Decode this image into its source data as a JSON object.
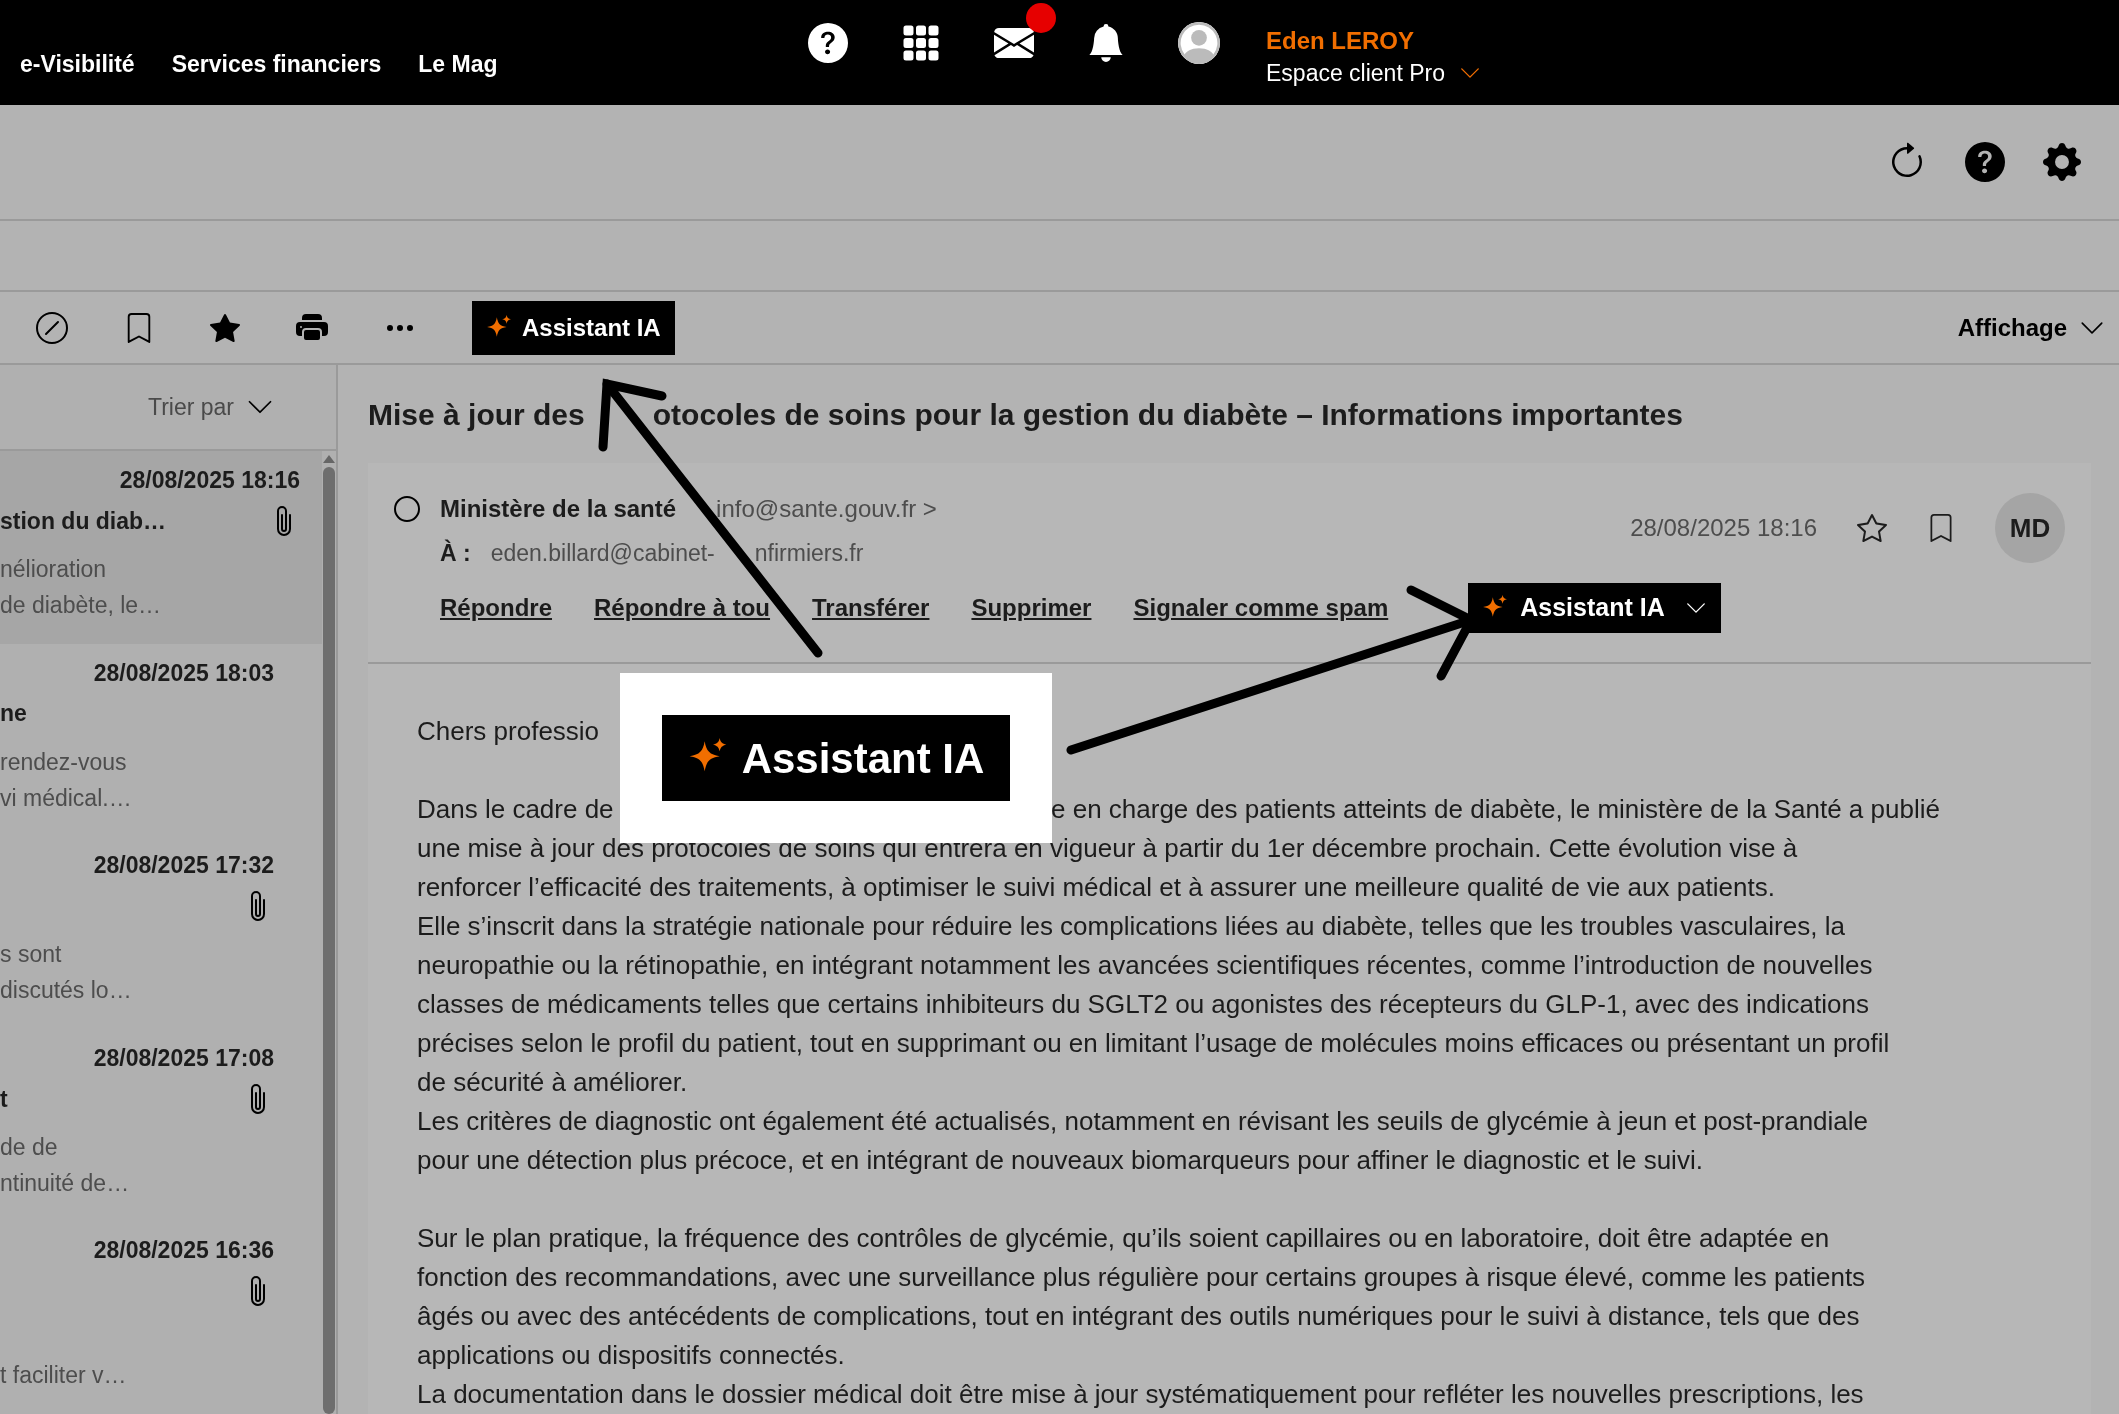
{
  "header": {
    "nav_links": [
      "e-Visibilité",
      "Services financiers",
      "Le Mag"
    ],
    "mail_unread": true,
    "user": {
      "name": "Eden LEROY",
      "account": "Espace client Pro"
    }
  },
  "toolbar": {
    "assistant_button": "Assistant IA",
    "view_menu": "Affichage"
  },
  "message_list": {
    "sort_label": "Trier par",
    "items": [
      {
        "date": "28/08/2025 18:16",
        "subject": "stion du diab…",
        "preview": [
          "nélioration",
          "de diabète, le…"
        ],
        "attachment": true,
        "selected": true
      },
      {
        "date": "28/08/2025 18:03",
        "subject": "ne",
        "preview": [
          "rendez-vous",
          "vi médical.…"
        ],
        "attachment": false,
        "selected": false
      },
      {
        "date": "28/08/2025 17:32",
        "preview": [
          "s sont",
          "discutés lo…"
        ],
        "attachment": true,
        "selected": false
      },
      {
        "date": "28/08/2025 17:08",
        "subject": "t",
        "preview": [
          "de de",
          "ntinuité de…"
        ],
        "attachment": true,
        "selected": false
      },
      {
        "date": "28/08/2025 16:36",
        "preview": [
          "t faciliter v…"
        ],
        "attachment": true,
        "selected": false
      }
    ]
  },
  "message": {
    "subject_parts": [
      "Mise à jour des",
      "otocoles de soins pour la gestion du diabète – Informations importantes"
    ],
    "checked": false,
    "sender": "Ministère de la santé",
    "sender_email": "info@sante.gouv.fr >",
    "to_label": "À :",
    "to_parts": [
      "eden.billard@cabinet-",
      "nfirmiers.fr"
    ],
    "date": "28/08/2025 18:16",
    "starred": false,
    "avatar": "MD",
    "actions": [
      "Répondre",
      "Répondre à tou",
      "Transférer",
      "Supprimer",
      "Signaler comme spam"
    ],
    "assistant_button": "Assistant IA",
    "body": [
      {
        "kind": "line",
        "text": "Chers professio"
      },
      {
        "kind": "spacer"
      },
      {
        "kind": "split",
        "left": "Dans le cadre de",
        "right": "e en charge des patients atteints de diabète, le ministère de la Santé a publié"
      },
      {
        "kind": "line",
        "text": "une mise à jour des protocoles de soins qui entrera en vigueur à partir du 1er décembre prochain. Cette évolution vise à"
      },
      {
        "kind": "line",
        "text": "renforcer l’efficacité des traitements, à optimiser le suivi médical et à assurer une meilleure qualité de vie aux patients."
      },
      {
        "kind": "line",
        "text": "Elle s’inscrit dans la stratégie nationale pour réduire les complications liées au diabète, telles que les troubles vasculaires, la"
      },
      {
        "kind": "line",
        "text": "neuropathie ou la rétinopathie, en intégrant notamment les avancées scientifiques récentes, comme l’introduction de nouvelles"
      },
      {
        "kind": "line",
        "text": "classes de médicaments telles que certains inhibiteurs du SGLT2 ou agonistes des récepteurs du GLP-1, avec des indications"
      },
      {
        "kind": "line",
        "text": "précises selon le profil du patient, tout en supprimant ou en limitant l’usage de molécules moins efficaces ou présentant un profil"
      },
      {
        "kind": "line",
        "text": "de sécurité à améliorer."
      },
      {
        "kind": "line",
        "text": "Les critères de diagnostic ont également été actualisés, notamment en révisant les seuils de glycémie à jeun et post-prandiale"
      },
      {
        "kind": "line",
        "text": "pour une détection plus précoce, et en intégrant de nouveaux biomarqueurs pour affiner le diagnostic et le suivi."
      },
      {
        "kind": "spacer"
      },
      {
        "kind": "line",
        "text": "Sur le plan pratique, la fréquence des contrôles de glycémie, qu’ils soient capillaires ou en laboratoire, doit être adaptée en"
      },
      {
        "kind": "line",
        "text": "fonction des recommandations, avec une surveillance plus régulière pour certains groupes à risque élevé, comme les patients"
      },
      {
        "kind": "line",
        "text": "âgés ou avec des antécédents de complications, tout en intégrant des outils numériques pour le suivi à distance, tels que des"
      },
      {
        "kind": "line",
        "text": "applications ou dispositifs connectés."
      },
      {
        "kind": "line",
        "text": "La documentation dans le dossier médical doit être mise à jour systématiquement pour refléter les nouvelles prescriptions, les"
      }
    ]
  },
  "callout": {
    "label": "Assistant IA"
  }
}
